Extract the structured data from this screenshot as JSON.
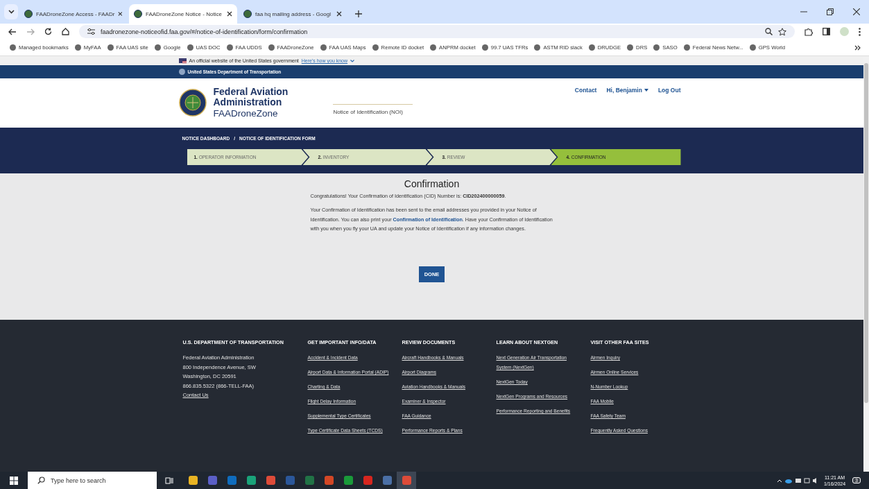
{
  "browser": {
    "tabs": [
      {
        "title": "FAADroneZone Access - FAADr",
        "selected": false
      },
      {
        "title": "FAADroneZone Notice - Notice",
        "selected": true
      },
      {
        "title": "faa hq mailing address - Googl",
        "selected": false
      }
    ],
    "url": "faadronezone-noticeofid.faa.gov/#/notice-of-identification/form/confirmation",
    "bookmarks": [
      {
        "label": "Managed bookmarks"
      },
      {
        "label": "MyFAA"
      },
      {
        "label": "FAA UAS site"
      },
      {
        "label": "Google"
      },
      {
        "label": "UAS DOC"
      },
      {
        "label": "FAA UDDS"
      },
      {
        "label": "FAADroneZone"
      },
      {
        "label": "FAA UAS Maps"
      },
      {
        "label": "Remote ID docket"
      },
      {
        "label": "ANPRM docket"
      },
      {
        "label": "99.7 UAS TFRs"
      },
      {
        "label": "ASTM RID slack"
      },
      {
        "label": "DRUDGE"
      },
      {
        "label": "DRS"
      },
      {
        "label": "SASO"
      },
      {
        "label": "Federal News Netw..."
      },
      {
        "label": "GPS World"
      }
    ]
  },
  "gov_banner": {
    "text": "An official website of the United States government",
    "link": "Here's how you know"
  },
  "agency_bar": "United States Department of Transportation",
  "header": {
    "title_lines": [
      "Federal Aviation",
      "Administration"
    ],
    "subtitle": "FAADroneZone",
    "app_name": "Notice of Identification (NOI)",
    "nav": [
      "Contact",
      "Hi, Benjamin",
      "Log Out"
    ]
  },
  "breadcrumb": [
    "NOTICE DASHBOARD",
    "/",
    "NOTICE OF IDENTIFICATION FORM"
  ],
  "steps": [
    {
      "number": "1.",
      "label": "OPERATOR INFORMATION",
      "selected": false
    },
    {
      "number": "2.",
      "label": "INVENTORY",
      "selected": false
    },
    {
      "number": "3.",
      "label": "REVIEW",
      "selected": false
    },
    {
      "number": "4.",
      "label": "CONFIRMATION",
      "selected": true
    }
  ],
  "confirmation": {
    "heading": "Confirmation",
    "cid_message": "Congratulations! Your Confirmation of Identification (CID) Number is: **CID202400000059**.",
    "paragraph_before": "Your Confirmation of Identification has been sent to the email addresses you provided in your Notice of Identification. You can also print your ",
    "paragraph_link": "Confirmation of Identification",
    "paragraph_after": ". Have your Confirmation of Identification with you when you fly your UA and update your Notice of Identification if any information changes.",
    "button": "DONE"
  },
  "footer": [
    {
      "heading": "U.S. DEPARTMENT OF TRANSPORTATION",
      "kind": "address",
      "lines": [
        "Federal Aviation Administration",
        "800 Independence Avenue, SW",
        "Washington, DC 20591",
        "866.835.5322 (866-TELL-FAA)"
      ],
      "links": [
        "Contact Us"
      ]
    },
    {
      "heading": "GET IMPORTANT INFO/DATA",
      "kind": "links",
      "links": [
        "Accident & Incident Data",
        "Airport Data & Information Portal (ADIP)",
        "Charting & Data",
        "Flight Delay Information",
        "Supplemental Type Certificates",
        "Type Certificate Data Sheets (TCDS)"
      ]
    },
    {
      "heading": "REVIEW DOCUMENTS",
      "kind": "links",
      "links": [
        "Aircraft Handbooks & Manuals",
        "Airport Diagrams",
        "Aviation Handbooks & Manuals",
        "Examiner & Inspector",
        "FAA Guidance",
        "Performance Reports & Plans"
      ]
    },
    {
      "heading": "LEARN ABOUT NEXTGEN",
      "kind": "links",
      "links": [
        "Next Generation Air Transportation System (NextGen)",
        "NextGen Today",
        "NextGen Programs and Resources",
        "Performance Reporting and Benefits"
      ]
    },
    {
      "heading": "VISIT OTHER FAA SITES",
      "kind": "links",
      "links": [
        "Airmen Inquiry",
        "Airmen Online Services",
        "N-Number Lookup",
        "FAA Mobile",
        "FAA Safety Team",
        "Frequently Asked Questions"
      ]
    }
  ],
  "taskbar": {
    "search_placeholder": "Type here to search",
    "time": "11:21 AM",
    "date": "1/16/2024",
    "notifications": "3"
  }
}
